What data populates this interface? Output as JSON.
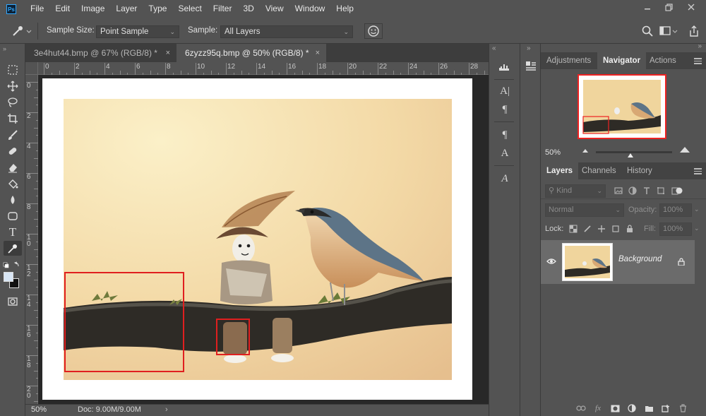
{
  "app": {
    "logo": "Ps"
  },
  "menu": [
    "File",
    "Edit",
    "Image",
    "Layer",
    "Type",
    "Select",
    "Filter",
    "3D",
    "View",
    "Window",
    "Help"
  ],
  "options": {
    "sample_size_label": "Sample Size:",
    "sample_size_value": "Point Sample",
    "sample_label": "Sample:",
    "sample_value": "All Layers"
  },
  "tabs": [
    {
      "label": "3e4hut44.bmp @ 67% (RGB/8) *",
      "active": false
    },
    {
      "label": "6zyzz95q.bmp @ 50% (RGB/8) *",
      "active": true
    }
  ],
  "tab_close": "×",
  "ruler_top": [
    "0",
    "2",
    "4",
    "6",
    "8",
    "10",
    "12",
    "14",
    "16",
    "18",
    "20",
    "22",
    "24",
    "26",
    "28"
  ],
  "ruler_left": [
    "0",
    "2",
    "4",
    "6",
    "8",
    "1\n0",
    "1\n2",
    "1\n4",
    "1\n6",
    "1\n8",
    "2\n0"
  ],
  "status": {
    "zoom": "50%",
    "doc": "Doc: 9.00M/9.00M",
    "arrow": "›"
  },
  "panels": {
    "top_tabs": [
      "Adjustments",
      "Navigator",
      "Actions"
    ],
    "navigator_zoom": "50%",
    "layer_tabs": [
      "Layers",
      "Channels",
      "History"
    ],
    "filter_kind": "Kind",
    "blend_mode": "Normal",
    "opacity_label": "Opacity:",
    "opacity_value": "100%",
    "lock_label": "Lock:",
    "fill_label": "Fill:",
    "fill_value": "100%",
    "layer_name": "Background"
  },
  "colors": {
    "highlight_box": "#e01f1f",
    "ui_bg": "#535353",
    "canvas_bg": "#282828",
    "accent_blue": "#31a8ff"
  }
}
